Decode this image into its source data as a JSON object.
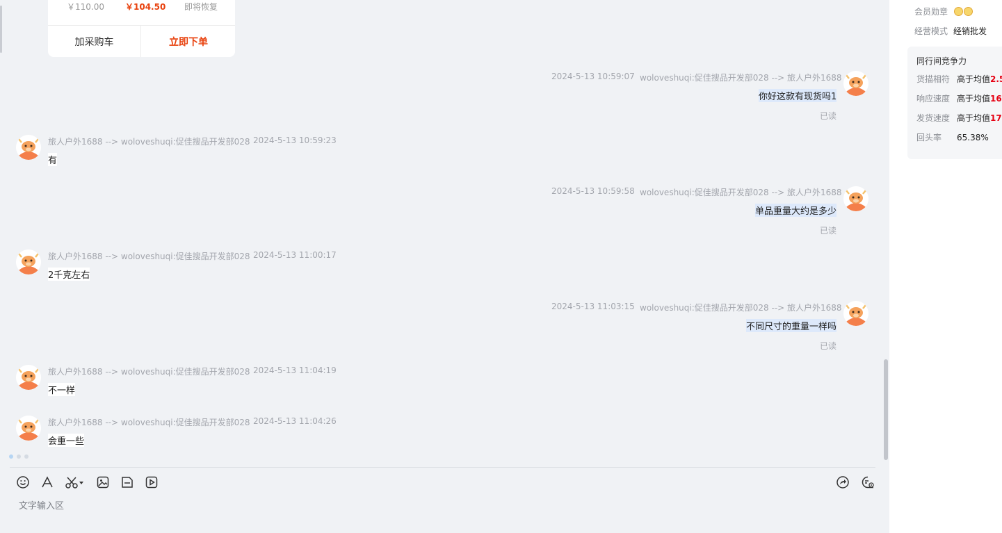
{
  "product_card": {
    "original_price": "￥110.00",
    "current_price": "￥104.50",
    "status": "即将恢复",
    "add_to_cart_label": "加采购车",
    "order_now_label": "立即下单"
  },
  "messages": [
    {
      "direction": "out",
      "timestamp": "2024-5-13 10:59:07",
      "route": "woloveshuqi:促佳搜品开发部028 --> 旅人户外1688",
      "text": "你好这款有现货吗1",
      "read": "已读"
    },
    {
      "direction": "in",
      "route": "旅人户外1688 --> woloveshuqi:促佳搜品开发部028",
      "timestamp": "2024-5-13 10:59:23",
      "text": "有"
    },
    {
      "direction": "out",
      "timestamp": "2024-5-13 10:59:58",
      "route": "woloveshuqi:促佳搜品开发部028 --> 旅人户外1688",
      "text": "单品重量大约是多少",
      "read": "已读"
    },
    {
      "direction": "in",
      "route": "旅人户外1688 --> woloveshuqi:促佳搜品开发部028",
      "timestamp": "2024-5-13 11:00:17",
      "text": "2千克左右"
    },
    {
      "direction": "out",
      "timestamp": "2024-5-13 11:03:15",
      "route": "woloveshuqi:促佳搜品开发部028 --> 旅人户外1688",
      "text": "不同尺寸的重量一样吗",
      "read": "已读"
    },
    {
      "direction": "in",
      "route": "旅人户外1688 --> woloveshuqi:促佳搜品开发部028",
      "timestamp": "2024-5-13 11:04:19",
      "text": "不一样"
    },
    {
      "direction": "in",
      "route": "旅人户外1688 --> woloveshuqi:促佳搜品开发部028",
      "timestamp": "2024-5-13 11:04:26",
      "text": "会重一些"
    }
  ],
  "toolbar": {
    "left_icons": [
      "emoji-icon",
      "font-icon",
      "scissors-icon",
      "image-icon",
      "file-icon",
      "video-icon"
    ],
    "right_icons": [
      "share-icon",
      "chat-settings-icon"
    ],
    "input_placeholder": "文字输入区"
  },
  "info_panel": {
    "member_badge_label": "会员勋章",
    "business_mode_label": "经营模式",
    "business_mode_value": "经销批发",
    "compete": {
      "title": "同行间竞争力",
      "rows": [
        {
          "label": "货描相符",
          "value": "高于均值",
          "number": "2.5"
        },
        {
          "label": "响应速度",
          "value": "高于均值",
          "number": "16"
        },
        {
          "label": "发货速度",
          "value": "高于均值",
          "number": "17"
        },
        {
          "label": "回头率",
          "value": "65.38%",
          "number": ""
        }
      ]
    }
  },
  "colors": {
    "chat_background": "#f0f2f5",
    "outgoing_bubble": "#dde9fb",
    "incoming_bubble": "#ffffff",
    "price_accent": "#e8400c",
    "highlight_number": "#e60012"
  }
}
